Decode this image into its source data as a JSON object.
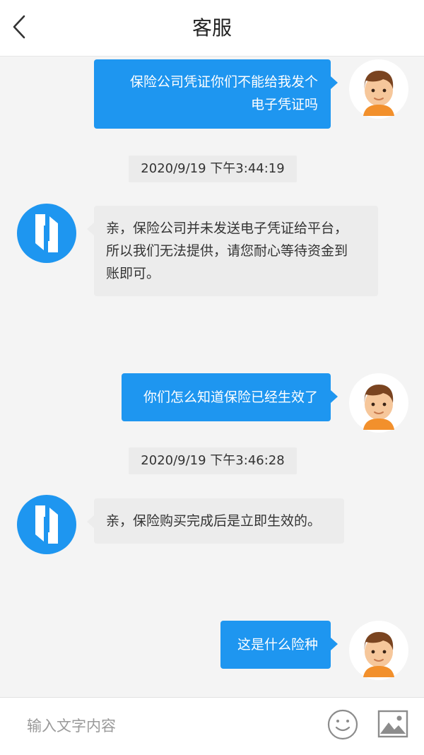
{
  "header": {
    "title": "客服",
    "back_icon": "chevron-left-icon"
  },
  "colors": {
    "user_bubble": "#1e96f0",
    "bot_bubble": "#ececec",
    "bot_logo": "#1e96f0"
  },
  "messages": [
    {
      "sender": "user",
      "text": "保险公司凭证你们不能给我发个\n电子凭证吗"
    },
    {
      "type": "timestamp",
      "text": "2020/9/19 下午3:44:19"
    },
    {
      "sender": "bot",
      "text": "亲，保险公司并未发送电子凭证给平台，\n所以我们无法提供，请您耐心等待资金到\n账即可。"
    },
    {
      "sender": "user",
      "text": "你们怎么知道保险已经生效了"
    },
    {
      "type": "timestamp",
      "text": "2020/9/19 下午3:46:28"
    },
    {
      "sender": "bot",
      "text": "亲，保险购买完成后是立即生效的。"
    },
    {
      "sender": "user",
      "text": "这是什么险种"
    }
  ],
  "input_bar": {
    "placeholder": "输入文字内容",
    "emoji_icon": "smiley-icon",
    "image_icon": "image-icon"
  }
}
